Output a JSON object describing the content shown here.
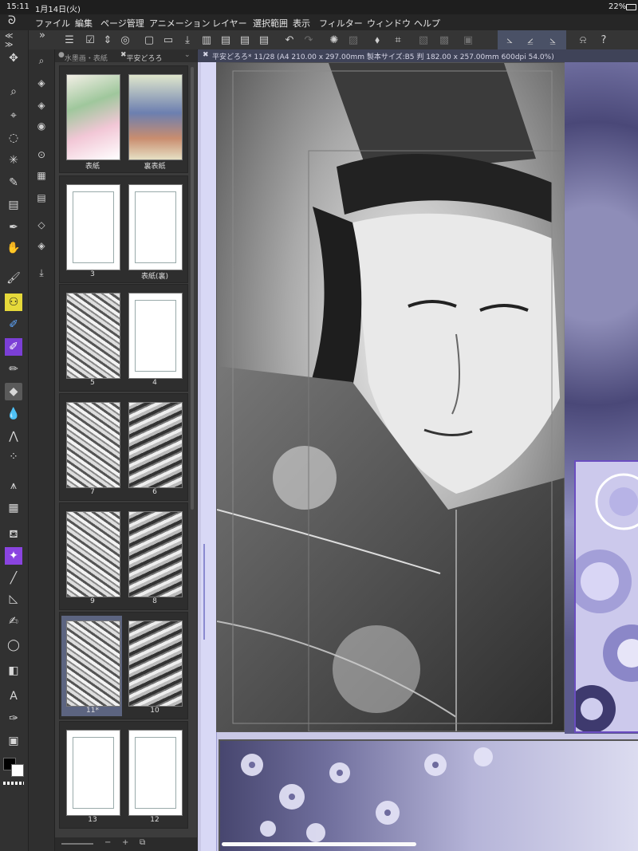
{
  "status": {
    "time": "15:11",
    "date": "1月14日(火)",
    "battery": "22%"
  },
  "menu": {
    "items": [
      "ファイル",
      "編集",
      "ページ管理",
      "アニメーション",
      "レイヤー",
      "選択範囲",
      "表示",
      "フィルター",
      "ウィンドウ",
      "ヘルプ"
    ]
  },
  "tools": [
    {
      "name": "move-icon",
      "glyph": "✥"
    },
    {
      "name": "zoom-icon",
      "glyph": "⌕"
    },
    {
      "name": "object-select-icon",
      "glyph": "⌖"
    },
    {
      "name": "lasso-icon",
      "glyph": "◌"
    },
    {
      "name": "magic-wand-icon",
      "glyph": "✳"
    },
    {
      "name": "pen-eyedrop-icon",
      "glyph": "✎"
    },
    {
      "name": "layer-move-icon",
      "glyph": "▤"
    },
    {
      "name": "eyedropper-icon",
      "glyph": "✒"
    },
    {
      "name": "hand-icon",
      "glyph": "✋"
    },
    {
      "name": "brush-icon",
      "glyph": "🖌"
    },
    {
      "name": "fill-pattern-icon",
      "glyph": "⚇"
    },
    {
      "name": "pencil-blue-icon",
      "glyph": "✐"
    },
    {
      "name": "pencil-purple-icon",
      "glyph": "✐"
    },
    {
      "name": "pen-icon",
      "glyph": "✏"
    },
    {
      "name": "eraser-icon",
      "glyph": "◆"
    },
    {
      "name": "blend-icon",
      "glyph": "💧"
    },
    {
      "name": "grass-brush-icon",
      "glyph": "⋀"
    },
    {
      "name": "spray-icon",
      "glyph": "⁘"
    },
    {
      "name": "decoration-icon",
      "glyph": "⩚"
    },
    {
      "name": "frame-icon",
      "glyph": "▦"
    },
    {
      "name": "bucket-icon",
      "glyph": "⛾"
    },
    {
      "name": "sparkle-icon",
      "glyph": "✦"
    },
    {
      "name": "line-icon",
      "glyph": "╱"
    },
    {
      "name": "figure-icon",
      "glyph": "◺"
    },
    {
      "name": "pen-curve-icon",
      "glyph": "✍"
    },
    {
      "name": "balloon-icon",
      "glyph": "◯"
    },
    {
      "name": "gradient-icon",
      "glyph": "◧"
    },
    {
      "name": "text-icon",
      "glyph": "A"
    },
    {
      "name": "fill-icon",
      "glyph": "✑"
    },
    {
      "name": "frame-shape-icon",
      "glyph": "▣"
    }
  ],
  "subtools": [
    {
      "name": "layer-add-icon",
      "glyph": "◈"
    },
    {
      "name": "layer-copy-icon",
      "glyph": "◈"
    },
    {
      "name": "layer-merge-icon",
      "glyph": "◉"
    },
    {
      "name": "layer-group-icon",
      "glyph": "⊙"
    },
    {
      "name": "layer-grid-icon",
      "glyph": "▦"
    },
    {
      "name": "film-icon",
      "glyph": "▤"
    },
    {
      "name": "stack-icon",
      "glyph": "◇"
    },
    {
      "name": "layers-icon",
      "glyph": "◈"
    },
    {
      "name": "export-icon",
      "glyph": "⤓"
    }
  ],
  "tabs": {
    "first": "水墨画・表紙",
    "second": "平安どろろ"
  },
  "document_tab": "平安どろろ* 11/28 (A4 210.00 x 297.00mm 製本サイズ:B5 判 182.00 x 257.00mm 600dpi 54.0%)",
  "pages": [
    {
      "left": "表紙",
      "right": "裏表紙",
      "kind": "cover"
    },
    {
      "left": "3",
      "right": "表紙(裏)",
      "kind": "blank"
    },
    {
      "left": "5",
      "right": "4",
      "kind": "mix"
    },
    {
      "left": "7",
      "right": "6",
      "kind": "manga"
    },
    {
      "left": "9",
      "right": "8",
      "kind": "manga"
    },
    {
      "left": "11*",
      "right": "10",
      "kind": "manga",
      "selected": true
    },
    {
      "left": "13",
      "right": "12",
      "kind": "blank"
    }
  ],
  "zoom": {
    "minus": "−",
    "plus": "+"
  },
  "colors": {
    "accent": "#5c6480",
    "canvas_bg": "#c9c8e6",
    "flower_border": "#6a4dc0"
  }
}
